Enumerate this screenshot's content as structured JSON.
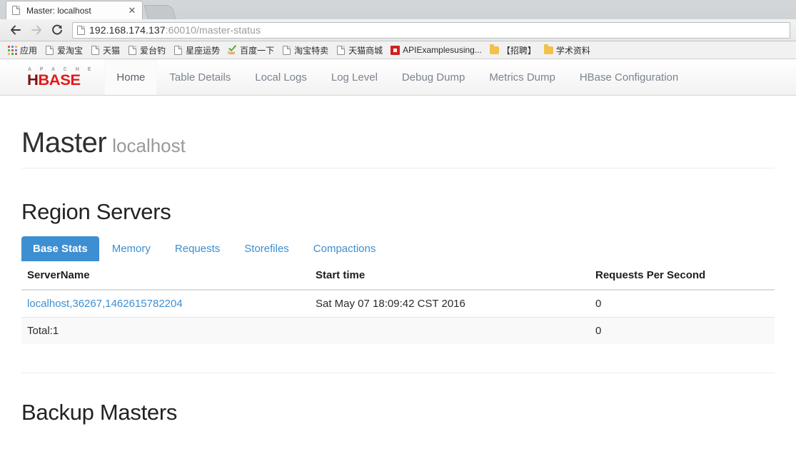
{
  "browser": {
    "tab": {
      "title": "Master: localhost",
      "favicon_icon": "page-icon",
      "close_icon": "close-icon"
    },
    "newtab_icon": "new-tab-icon",
    "back_icon": "back-arrow-icon",
    "forward_icon": "forward-arrow-icon",
    "reload_icon": "reload-icon",
    "omnibox": {
      "site_icon": "page-icon",
      "url_host": "192.168.174.137",
      "url_path": ":60010/master-status",
      "url_full": "192.168.174.137:60010/master-status"
    },
    "bookmarks": [
      {
        "label": "应用",
        "icon": "apps-grid-icon"
      },
      {
        "label": "爱淘宝",
        "icon": "page-icon"
      },
      {
        "label": "天猫",
        "icon": "page-icon"
      },
      {
        "label": "爱台钓",
        "icon": "page-icon"
      },
      {
        "label": "星座运势",
        "icon": "page-icon"
      },
      {
        "label": "百度一下",
        "icon": "hao123-icon"
      },
      {
        "label": "淘宝特卖",
        "icon": "page-icon"
      },
      {
        "label": "天猫商城",
        "icon": "page-icon"
      },
      {
        "label": "APIExamplesusing...",
        "icon": "pdf-icon"
      },
      {
        "label": "【招聘】",
        "icon": "folder-icon"
      },
      {
        "label": "学术资料",
        "icon": "folder-icon"
      }
    ]
  },
  "hbase": {
    "brand": {
      "apache_text": "A P A C H E",
      "name_first": "H",
      "name_rest": "BASE"
    },
    "nav": [
      {
        "label": "Home",
        "active": true
      },
      {
        "label": "Table Details",
        "active": false
      },
      {
        "label": "Local Logs",
        "active": false
      },
      {
        "label": "Log Level",
        "active": false
      },
      {
        "label": "Debug Dump",
        "active": false
      },
      {
        "label": "Metrics Dump",
        "active": false
      },
      {
        "label": "HBase Configuration",
        "active": false
      }
    ],
    "header": {
      "title": "Master",
      "subtitle": "localhost"
    },
    "region_servers": {
      "heading": "Region Servers",
      "tabs": [
        {
          "label": "Base Stats",
          "active": true
        },
        {
          "label": "Memory",
          "active": false
        },
        {
          "label": "Requests",
          "active": false
        },
        {
          "label": "Storefiles",
          "active": false
        },
        {
          "label": "Compactions",
          "active": false
        }
      ],
      "columns": [
        "ServerName",
        "Start time",
        "Requests Per Second"
      ],
      "rows": [
        {
          "server_name": "localhost,36267,1462615782204",
          "start_time": "Sat May 07 18:09:42 CST 2016",
          "requests_per_second": "0"
        }
      ],
      "total_row": {
        "label": "Total:1",
        "start_time": "",
        "requests_per_second": "0"
      }
    },
    "backup_masters": {
      "heading": "Backup Masters"
    }
  },
  "colors": {
    "accent_blue": "#3d8fd2",
    "link_blue": "#3d8fd2",
    "hbase_red": "#e01b1b",
    "hbase_dark_red": "#7d1313"
  }
}
